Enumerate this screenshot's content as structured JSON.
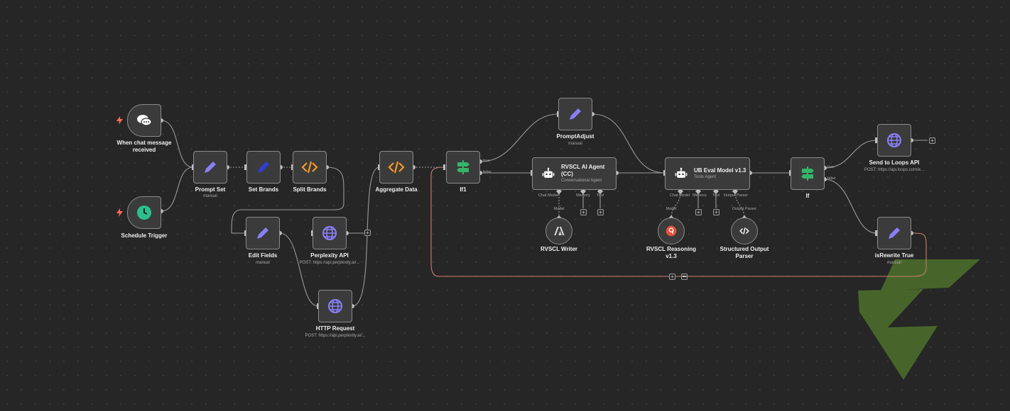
{
  "nodes": {
    "chat_trigger": {
      "title": "When chat message received"
    },
    "schedule_trigger": {
      "title": "Schedule Trigger"
    },
    "prompt_set": {
      "title": "Prompt Set",
      "subtitle": "manual"
    },
    "set_brands": {
      "title": "Set Brands"
    },
    "split_brands": {
      "title": "Split Brands"
    },
    "edit_fields": {
      "title": "Edit Fields",
      "subtitle": "manual"
    },
    "perplexity_api": {
      "title": "Perplexity API",
      "subtitle": "POST: https://api.perplexity.ai/..."
    },
    "http_request": {
      "title": "HTTP Request",
      "subtitle": "POST: https://api.perplexity.ai/..."
    },
    "aggregate_data": {
      "title": "Aggregate Data"
    },
    "if1": {
      "title": "If1",
      "true_label": "true",
      "false_label": "false"
    },
    "prompt_adjust": {
      "title": "PromptAdjust",
      "subtitle": "manual"
    },
    "rvscl_agent": {
      "title_line1": "RVSCL AI Agent",
      "title_line2": "(CC)",
      "subtitle": "Conversational Agent",
      "ports": {
        "chat_model": "Chat Model*",
        "memory": "Memory",
        "tool": "Tool",
        "model": "Model"
      }
    },
    "rvscl_writer": {
      "title": "RVSCL Writer"
    },
    "ub_eval": {
      "title": "UB Eval Model v1.3",
      "subtitle": "Tools Agent",
      "ports": {
        "chat_model": "Chat Model",
        "memory": "Memory",
        "tool": "Tool",
        "output_parser": "Output Parser",
        "model": "Model",
        "output_parser2": "Output Parser"
      }
    },
    "rvscl_reasoning": {
      "title_line1": "RVSCL Reasoning",
      "title_line2": "v1.3"
    },
    "structured_parser": {
      "title_line1": "Structured Output",
      "title_line2": "Parser"
    },
    "if": {
      "title": "If",
      "true_label": "true",
      "false_label": "false"
    },
    "send_loops": {
      "title": "Send to Loops API",
      "subtitle": "POST: https://api.loops.com/e..."
    },
    "is_rewrite": {
      "title": "isRewrite True",
      "subtitle": "manual"
    }
  },
  "icons": {
    "chat": "chat-bubbles-icon",
    "clock": "clock-icon",
    "pencil": "pencil-icon",
    "code": "code-icon",
    "globe": "globe-icon",
    "signpost": "signpost-icon",
    "robot": "robot-icon",
    "anthropic": "anthropic-icon",
    "bolt": "bolt-icon"
  },
  "colors": {
    "background": "#262626",
    "node": "#3b3b3b",
    "border": "#8a8a8a",
    "wire": "#9a9a9a",
    "loop_wire": "#c97d6a",
    "pencil": "#8b7ff5",
    "brand_pencil": "#2c3fd6",
    "code": "#f39a28",
    "globe": "#8b7ff5",
    "signpost": "#35b46a",
    "clock": "#2bbf8e",
    "bolt": "#ff6b5a",
    "logo": "#4c6a2a"
  }
}
